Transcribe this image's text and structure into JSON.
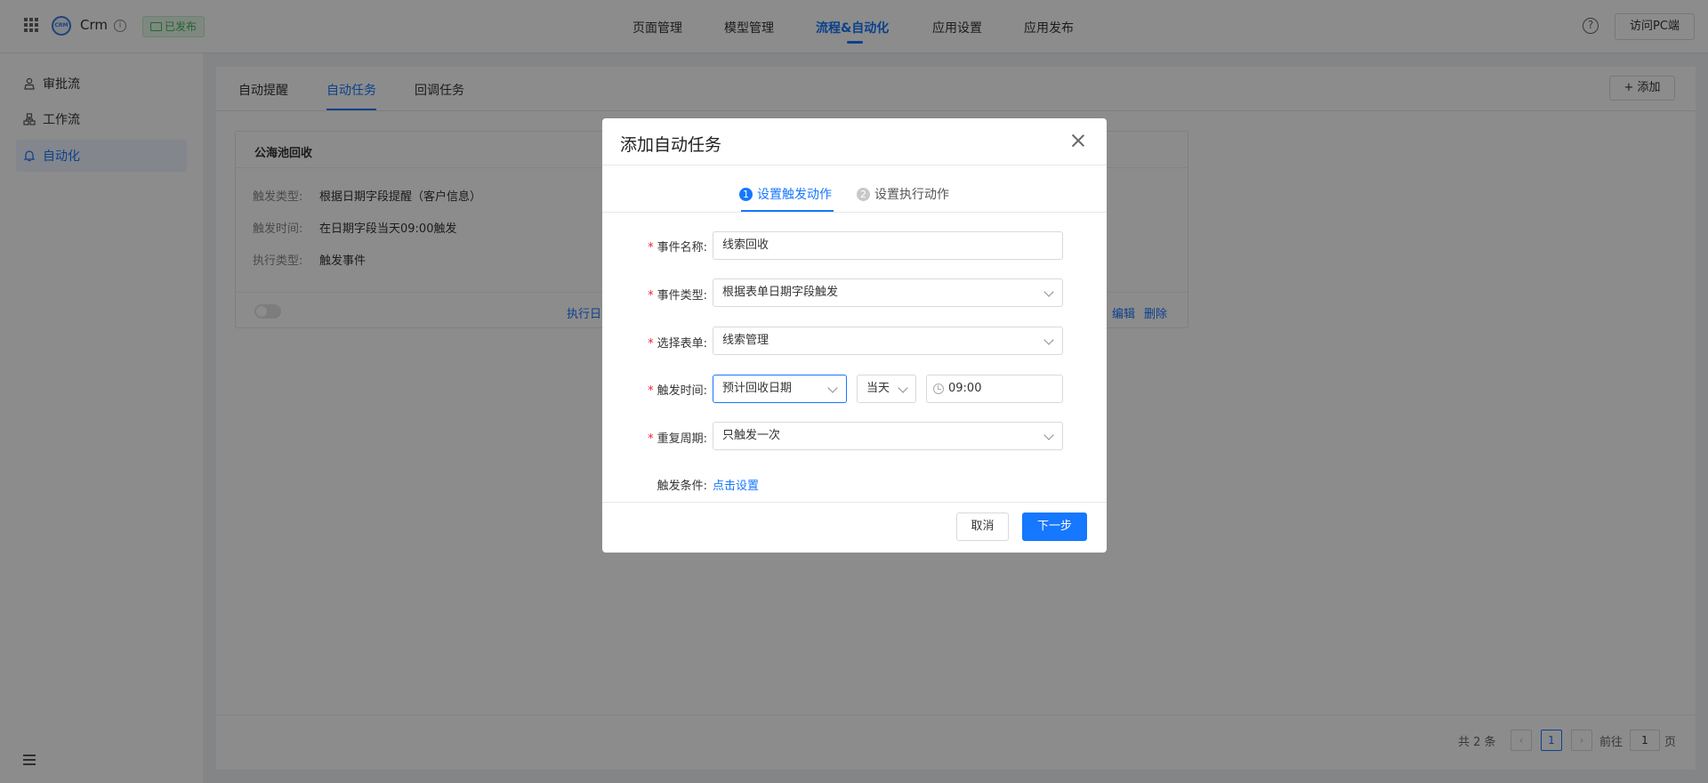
{
  "app": {
    "logo_text": "CRM",
    "name": "Crm",
    "status": "已发布"
  },
  "nav": {
    "items": [
      "页面管理",
      "模型管理",
      "流程&自动化",
      "应用设置",
      "应用发布"
    ],
    "active_index": 2
  },
  "header": {
    "visit_pc": "访问PC端"
  },
  "sidebar": {
    "items": [
      {
        "label": "审批流",
        "icon": "approval-user-icon"
      },
      {
        "label": "工作流",
        "icon": "workflow-icon"
      },
      {
        "label": "自动化",
        "icon": "bell-icon"
      }
    ],
    "active_index": 2
  },
  "tabs": {
    "items": [
      "自动提醒",
      "自动任务",
      "回调任务"
    ],
    "active_index": 1
  },
  "toolbar": {
    "add_label": "添加"
  },
  "card": {
    "title": "公海池回收",
    "rows": [
      {
        "key": "触发类型:",
        "value": "根据日期字段提醒（客户信息）"
      },
      {
        "key": "触发时间:",
        "value": "在日期字段当天09:00触发"
      },
      {
        "key": "执行类型:",
        "value": "触发事件"
      }
    ],
    "link_partial": "执行日",
    "edit": "编辑",
    "delete": "删除"
  },
  "pagination": {
    "total": "共 2 条",
    "current": "1",
    "goto_prefix": "前往",
    "goto_value": "1",
    "goto_suffix": "页"
  },
  "modal": {
    "title": "添加自动任务",
    "steps": [
      {
        "num": "1",
        "label": "设置触发动作"
      },
      {
        "num": "2",
        "label": "设置执行动作"
      }
    ],
    "fields": {
      "event_name": {
        "label": "事件名称:",
        "value": "线索回收"
      },
      "event_type": {
        "label": "事件类型:",
        "value": "根据表单日期字段触发"
      },
      "form": {
        "label": "选择表单:",
        "value": "线索管理"
      },
      "trigger_time": {
        "label": "触发时间:",
        "date_field": "预计回收日期",
        "day": "当天",
        "time": "09:00"
      },
      "repeat": {
        "label": "重复周期:",
        "value": "只触发一次"
      },
      "condition": {
        "label": "触发条件:",
        "link": "点击设置"
      }
    },
    "cancel": "取消",
    "next": "下一步"
  }
}
